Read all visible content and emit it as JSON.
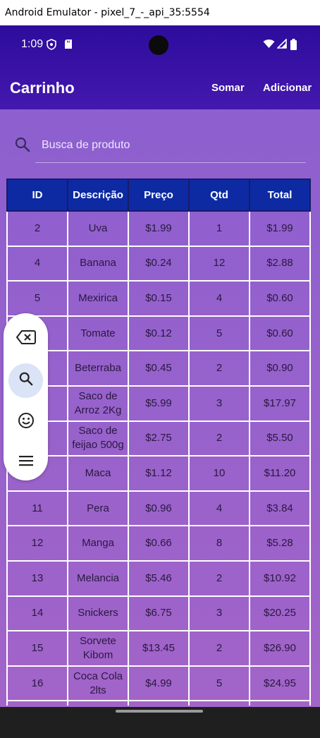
{
  "window": {
    "title": "Android Emulator - pixel_7_-_api_35:5554"
  },
  "status_bar": {
    "time": "1:09"
  },
  "app_bar": {
    "title": "Carrinho",
    "actions": [
      "Somar",
      "Adicionar"
    ]
  },
  "search": {
    "placeholder": "Busca de produto",
    "value": ""
  },
  "table": {
    "headers": [
      "ID",
      "Descrição",
      "Preço",
      "Qtd",
      "Total"
    ],
    "rows": [
      [
        "2",
        "Uva",
        "$1.99",
        "1",
        "$1.99"
      ],
      [
        "4",
        "Banana",
        "$0.24",
        "12",
        "$2.88"
      ],
      [
        "5",
        "Mexirica",
        "$0.15",
        "4",
        "$0.60"
      ],
      [
        "",
        "Tomate",
        "$0.12",
        "5",
        "$0.60"
      ],
      [
        "",
        "Beterraba",
        "$0.45",
        "2",
        "$0.90"
      ],
      [
        "",
        "Saco de Arroz 2Kg",
        "$5.99",
        "3",
        "$17.97"
      ],
      [
        "",
        "Saco de feijao 500g",
        "$2.75",
        "2",
        "$5.50"
      ],
      [
        "",
        "Maca",
        "$1.12",
        "10",
        "$11.20"
      ],
      [
        "11",
        "Pera",
        "$0.96",
        "4",
        "$3.84"
      ],
      [
        "12",
        "Manga",
        "$0.66",
        "8",
        "$5.28"
      ],
      [
        "13",
        "Melancia",
        "$5.46",
        "2",
        "$10.92"
      ],
      [
        "14",
        "Snickers",
        "$6.75",
        "3",
        "$20.25"
      ],
      [
        "15",
        "Sorvete Kibom",
        "$13.45",
        "2",
        "$26.90"
      ],
      [
        "16",
        "Coca Cola 2lts",
        "$4.99",
        "5",
        "$24.95"
      ],
      [
        "",
        "",
        "",
        "",
        ""
      ]
    ]
  },
  "floating_toolbar": {
    "buttons": [
      {
        "icon": "backspace-icon",
        "active": false
      },
      {
        "icon": "search-icon",
        "active": true
      },
      {
        "icon": "emoji-icon",
        "active": false
      },
      {
        "icon": "menu-icon",
        "active": false
      }
    ]
  },
  "colors": {
    "app_bar": "#2d0c9c",
    "header_cell": "#0d2aa3",
    "background_top": "#8a5fd0",
    "background_bottom": "#a364c8"
  }
}
